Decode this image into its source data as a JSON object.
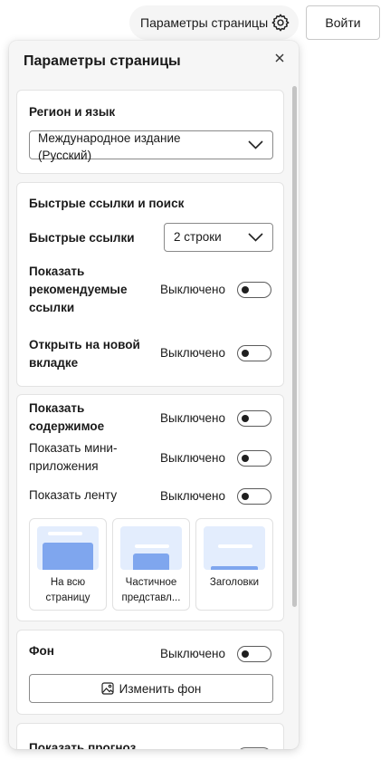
{
  "header": {
    "settings_label": "Параметры страницы",
    "signin_label": "Войти"
  },
  "panel": {
    "title": "Параметры страницы"
  },
  "region": {
    "title": "Регион и язык",
    "selected_line1": "Международное издание",
    "selected_line2": "(Русский)"
  },
  "quicklinks": {
    "title": "Быстрые ссылки и поиск",
    "quick_links_label": "Быстрые ссылки",
    "quick_links_value": "2 строки",
    "recommended_line1": "Показать",
    "recommended_line2": "рекомендуемые",
    "recommended_line3": "ссылки",
    "recommended_state": "Выключено",
    "new_tab_line1": "Открыть на новой",
    "new_tab_line2": "вкладке",
    "new_tab_state": "Выключено"
  },
  "content": {
    "show_content_line1": "Показать",
    "show_content_line2": "содержимое",
    "show_content_state": "Выключено",
    "widgets_line1": "Показать мини-",
    "widgets_line2": "приложения",
    "widgets_state": "Выключено",
    "feed_label": "Показать ленту",
    "feed_state": "Выключено",
    "feed_options": [
      {
        "line1": "На всю",
        "line2": "страницу"
      },
      {
        "line1": "Частичное",
        "line2": "представл..."
      },
      {
        "line1": "Заголовки",
        "line2": ""
      }
    ]
  },
  "background": {
    "title": "Фон",
    "state": "Выключено",
    "change_button": "Изменить фон"
  },
  "forecast": {
    "partial_label": "Показать прогноз"
  },
  "colors": {
    "accent_thumb": "#7fa6ee",
    "thumb_bg": "#e3edfd"
  }
}
